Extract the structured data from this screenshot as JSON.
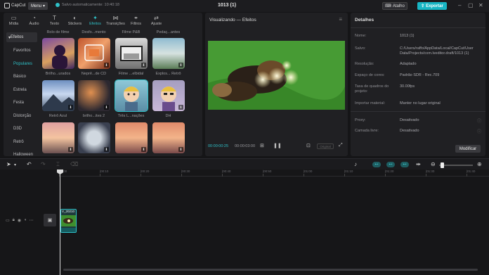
{
  "app": {
    "logo_text": "CapCut",
    "menu_label": "Menu",
    "autosave_text": "Salvo automaticamente: 10:40:18",
    "project_title": "1013 (1)",
    "shortcut_label": "Atalho",
    "export_label": "Exportar"
  },
  "categories": [
    {
      "icon": "▭",
      "label": "Mídia"
    },
    {
      "icon": "◔",
      "label": "Áudio"
    },
    {
      "icon": "T",
      "label": "Texto"
    },
    {
      "icon": "◐",
      "label": "Stickers"
    },
    {
      "icon": "✦",
      "label": "Efeitos",
      "active": true
    },
    {
      "icon": "⋈",
      "label": "Transições"
    },
    {
      "icon": "⚭",
      "label": "Filtros"
    },
    {
      "icon": "⇄",
      "label": "Ajuste"
    }
  ],
  "subnav": {
    "header": "Efeitos",
    "items": [
      {
        "label": "Favoritos"
      },
      {
        "label": "Populares",
        "active": true
      },
      {
        "label": "Básico"
      },
      {
        "label": "Estrela"
      },
      {
        "label": "Festa"
      },
      {
        "label": "Distorção"
      },
      {
        "label": "D3D"
      },
      {
        "label": "Retrô"
      },
      {
        "label": "Halloween"
      }
    ]
  },
  "effects": {
    "top_labels": [
      "Rolo de filme",
      "Desfo...mento",
      "Filme P&B",
      "Pedaç...antes"
    ],
    "rows": [
      [
        {
          "name": "Brilho...urados",
          "download": false
        },
        {
          "name": "Neprê...de CD",
          "download": true
        },
        {
          "name": "Filme ...elbidal",
          "download": true
        },
        {
          "name": "Explos... Retrô",
          "download": true
        }
      ],
      [
        {
          "name": "Retrô Azul",
          "download": true
        },
        {
          "name": "brilho...ites 2",
          "download": true
        },
        {
          "name": "Três L...nações",
          "download": false,
          "selected": true
        },
        {
          "name": "DH",
          "download": true
        }
      ],
      [
        {
          "name": "",
          "download": true
        },
        {
          "name": "",
          "download": true
        },
        {
          "name": "",
          "download": true
        },
        {
          "name": "",
          "download": true
        }
      ]
    ]
  },
  "viewer": {
    "title": "Visualizando — Efeitos",
    "current_time": "00:00:00:25",
    "total_time": "00:00:03:00",
    "ratio_label": "Original"
  },
  "details": {
    "title": "Detalhes",
    "fields": [
      {
        "key": "Nome:",
        "value": "1013 (1)"
      },
      {
        "key": "Salvo:",
        "value": "C:/Users/raffo/AppData/Local/CapCut/User Data/Projects/com.lveditor.draft/1013 (1)"
      },
      {
        "key": "Resolução:",
        "value": "Adaptado"
      },
      {
        "key": "Espaço de cores:",
        "value": "Padrão SDR - Rec.709"
      },
      {
        "key": "Taxa de quadros do projeto:",
        "value": "30.00fps"
      },
      {
        "key": "Importar material:",
        "value": "Manter no lugar original"
      },
      {
        "key": "Proxy:",
        "value": "Desativado"
      },
      {
        "key": "Camada livre:",
        "value": "Desativado"
      }
    ],
    "modify_label": "Modificar"
  },
  "timeline": {
    "ruler_ticks": [
      "00:00",
      "|00:10",
      "|00:20",
      "|00:30",
      "|00:40",
      "|00:50",
      "|01:00",
      "|01:10",
      "|01:20",
      "|01:30",
      "|01:40"
    ],
    "clip_name": "V_20210",
    "zoom_level": 0.05
  },
  "colors": {
    "accent": "#2fc1c8",
    "export_bg": "#18b6c5",
    "panel_bg": "#202023",
    "app_bg": "#151517"
  }
}
